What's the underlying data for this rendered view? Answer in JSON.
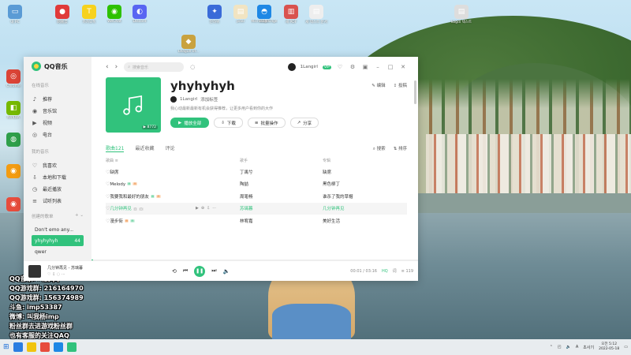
{
  "desktop": {
    "icons": [
      {
        "label": "내 PC",
        "color": "#5a9bd5",
        "glyph": "▭"
      },
      {
        "label": "网易云",
        "color": "#e03a3a",
        "glyph": "●"
      },
      {
        "label": "카카오톡",
        "color": "#f7d21e",
        "glyph": "T"
      },
      {
        "label": "WeChat",
        "color": "#2dc100",
        "glyph": "◉"
      },
      {
        "label": "Discord",
        "color": "#5865f2",
        "glyph": "◐"
      },
      {
        "label": "Edge",
        "color": "#2a7de1",
        "glyph": "⬤"
      },
      {
        "label": "Chrome",
        "color": "#db4437",
        "glyph": "◎"
      },
      {
        "label": "NVIDIA",
        "color": "#76b900",
        "glyph": "◧"
      },
      {
        "label": "",
        "color": "#2e9f4a",
        "glyph": "◍"
      },
      {
        "label": "",
        "color": "#f39c12",
        "glyph": "◉"
      },
      {
        "label": "",
        "color": "#e74c3c",
        "glyph": "◉"
      },
      {
        "label": "단하위",
        "color": "#3a6bd8",
        "glyph": "✦"
      },
      {
        "label": "pdai",
        "color": "#f1e4c2",
        "glyph": "▤"
      },
      {
        "label": "Microsoft Edge",
        "color": "#1e88e5",
        "glyph": "◓"
      },
      {
        "label": "새 PDF",
        "color": "#d9534f",
        "glyph": "▥"
      },
      {
        "label": "새 텍스트 문서",
        "color": "#eeeeee",
        "glyph": "▤"
      },
      {
        "label": "kogdi 텍스트",
        "color": "#dddddd",
        "glyph": "▤"
      },
      {
        "label": "League of...",
        "color": "#c9a23f",
        "glyph": "◆"
      }
    ],
    "overlay_lines": [
      "QQ音乐: 叫我qq",
      "QQ游戏群: 216164970",
      "QQ游戏群: 156374989",
      "斗鱼: imp53387",
      "微博: 叫我杨imp",
      "粉丝群去进游戏粉丝群",
      "也有客服的关注QAQ"
    ]
  },
  "app": {
    "name": "QQ音乐",
    "search_placeholder": "搜索音乐",
    "user_name": "1Langirl",
    "vip_badge": "VIP",
    "sidebar": {
      "online_heading": "在线音乐",
      "online_items": [
        {
          "label": "推荐",
          "icon": "♪"
        },
        {
          "label": "音乐馆",
          "icon": "◉"
        },
        {
          "label": "视频",
          "icon": "▶"
        },
        {
          "label": "电台",
          "icon": "◎"
        }
      ],
      "mine_heading": "我的音乐",
      "mine_items": [
        {
          "label": "我喜欢",
          "icon": "♡"
        },
        {
          "label": "本地和下载",
          "icon": "⇩"
        },
        {
          "label": "最近播放",
          "icon": "◷"
        },
        {
          "label": "试听列表",
          "icon": "≡"
        }
      ],
      "created_heading": "创建的歌单",
      "playlists": [
        {
          "label": "Don't emo any..."
        },
        {
          "label": "yhyhyhyh",
          "count": "44",
          "active": true
        },
        {
          "label": "qwer"
        }
      ]
    },
    "playlist": {
      "title": "yhyhyhyh",
      "count_badge": "▶ 8772",
      "creator": "1Langirl",
      "add_tag": "添加标签",
      "description": "我心动最新最新有机会获得推荐，让更多用户看到你的大作",
      "edit": "编辑",
      "share_top": "投稿",
      "buttons": {
        "play_all": "播放全部",
        "download": "下载",
        "batch": "批量操作",
        "share": "分享"
      },
      "tabs": [
        {
          "label": "歌曲121",
          "active": true
        },
        {
          "label": "最近收藏"
        },
        {
          "label": "评论"
        }
      ],
      "search": "搜索",
      "sort": "排序",
      "columns": {
        "song": "歌曲 ≡",
        "artist": "歌手",
        "album": "专辑"
      },
      "songs": [
        {
          "title": "缺席",
          "artist": "丁禹兮",
          "album": "缺席",
          "tags": []
        },
        {
          "title": "Melody",
          "artist": "陶喆",
          "album": "黑色柳丁",
          "tags": [
            "g",
            "o"
          ]
        },
        {
          "title": "我要我和最好的朋友",
          "artist": "周笔畅",
          "album": "谁杀了我的草帽",
          "tags": [
            "g",
            "o"
          ]
        },
        {
          "title": "几分钟再见",
          "artist": "苏璃暮",
          "album": "几分钟再见",
          "tags": [
            "b",
            "b"
          ],
          "highlight": true
        },
        {
          "title": "漫步街",
          "artist": "林宥嘉",
          "album": "美好生活",
          "tags": [
            "o",
            "g"
          ]
        }
      ]
    },
    "player": {
      "song": "几分钟再见",
      "artist": "苏璃暮",
      "time": "00:01 / 03:16",
      "quality": "HQ",
      "volume_label": "119",
      "progress": 0.005
    }
  },
  "taskbar": {
    "tray_lang": "A",
    "tray_ime": "초사기",
    "time": "오전 5:12",
    "date": "2022-05-18",
    "apps": [
      "#2a7de1",
      "#f1c40f",
      "#e74c3c",
      "#1e88e5",
      "#31c27c"
    ]
  }
}
